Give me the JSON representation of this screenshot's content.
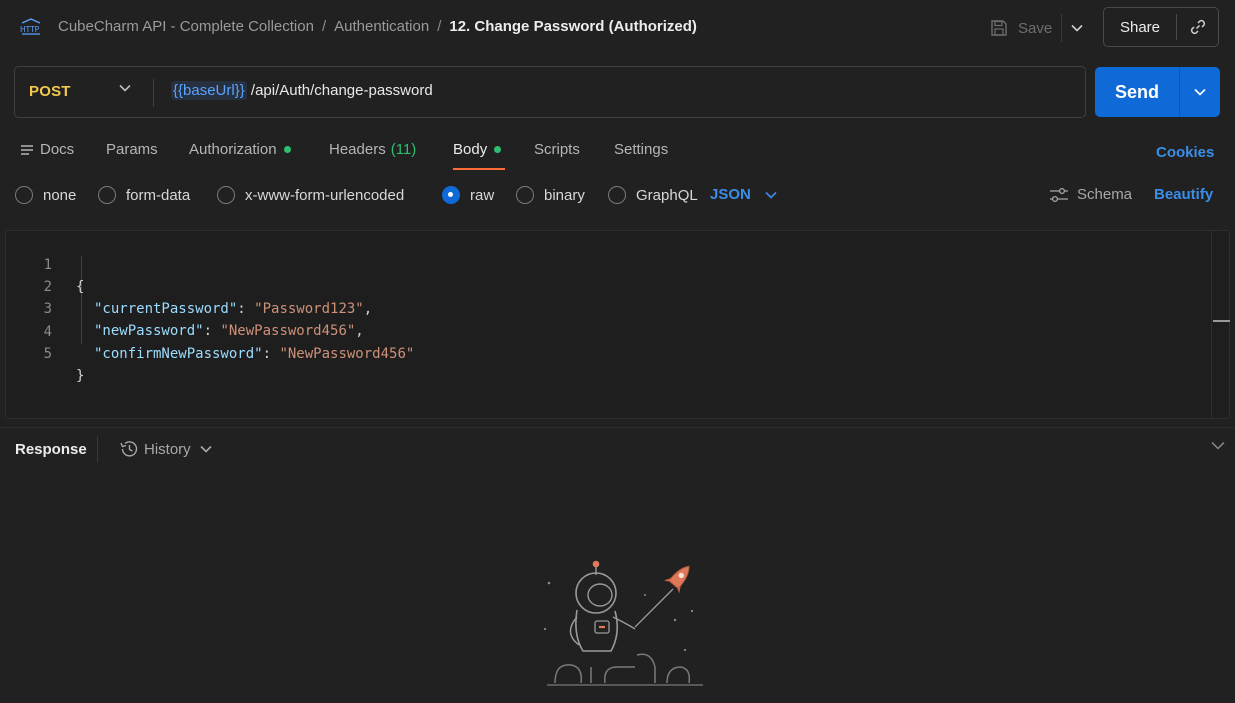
{
  "header": {
    "icon": "http-icon",
    "breadcrumb": [
      "CubeCharm API - Complete Collection",
      "Authentication",
      "12. Change Password (Authorized)"
    ],
    "breadcrumb_separator": "/",
    "save_label": "Save",
    "share_label": "Share"
  },
  "request": {
    "method": "POST",
    "url_variable": "{{baseUrl}}",
    "url_path": " /api/Auth/change-password",
    "send_label": "Send"
  },
  "tabs": {
    "docs": "Docs",
    "params": "Params",
    "authorization": "Authorization",
    "headers": "Headers",
    "headers_count": "(11)",
    "body": "Body",
    "scripts": "Scripts",
    "settings": "Settings",
    "active": "Body",
    "cookies": "Cookies"
  },
  "body_types": {
    "none": "none",
    "form_data": "form-data",
    "urlencoded": "x-www-form-urlencoded",
    "raw": "raw",
    "binary": "binary",
    "graphql": "GraphQL",
    "selected": "raw",
    "language": "JSON",
    "schema": "Schema",
    "beautify": "Beautify"
  },
  "editor": {
    "line_numbers": [
      "1",
      "2",
      "3",
      "4",
      "5"
    ],
    "open_brace": "{",
    "close_brace": "}",
    "fields": [
      {
        "key": "\"currentPassword\"",
        "value": "\"Password123\"",
        "trail": ","
      },
      {
        "key": "\"newPassword\"",
        "value": "\"NewPassword456\"",
        "trail": ","
      },
      {
        "key": "\"confirmNewPassword\"",
        "value": "\"NewPassword456\"",
        "trail": ""
      }
    ]
  },
  "response": {
    "label": "Response",
    "history": "History"
  },
  "colors": {
    "accent_blue": "#0f6ad8",
    "method_yellow": "#f2c94c",
    "active_tab": "#ff6c37",
    "status_dot": "#2fbf71"
  }
}
